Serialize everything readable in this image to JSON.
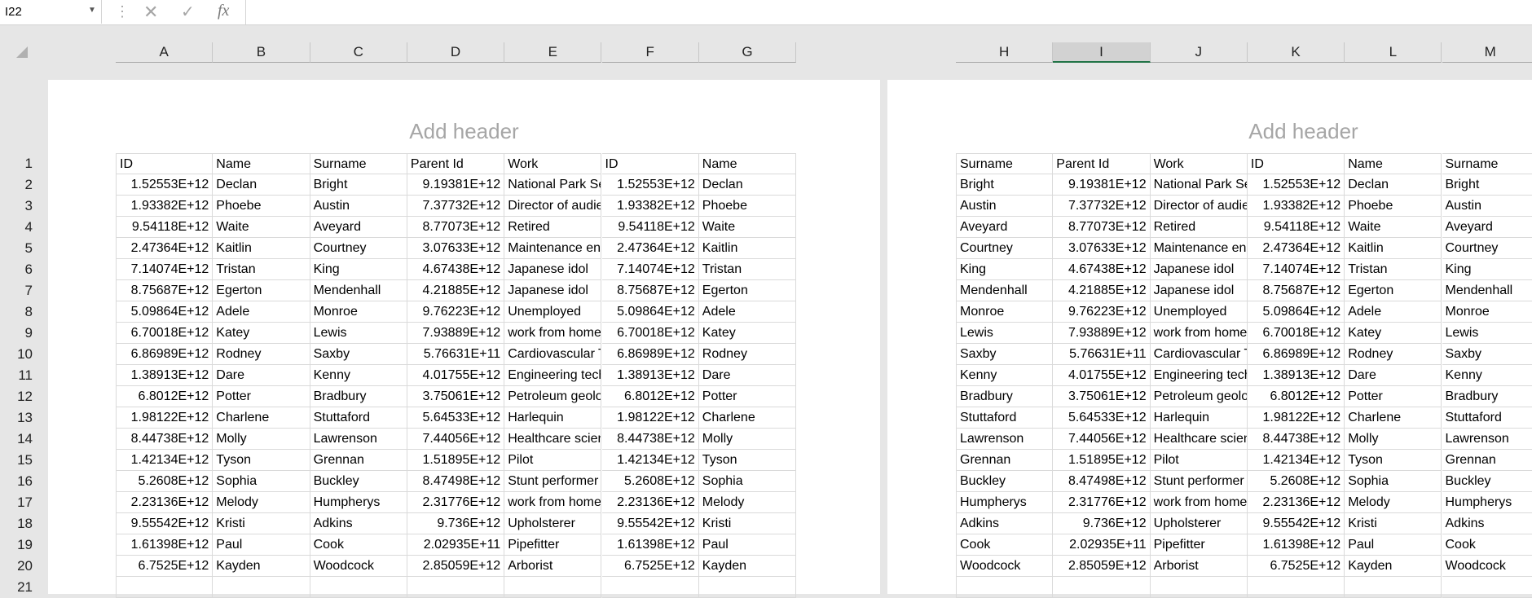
{
  "formula_bar": {
    "name_box": "I22",
    "fx_label": "fx",
    "cancel_glyph": "✕",
    "enter_glyph": "✓",
    "formula_value": ""
  },
  "columns_left": [
    "A",
    "B",
    "C",
    "D",
    "E",
    "F",
    "G"
  ],
  "columns_right": [
    "H",
    "I",
    "J",
    "K",
    "L",
    "M"
  ],
  "selected_column": "I",
  "row_numbers": [
    "1",
    "2",
    "3",
    "4",
    "5",
    "6",
    "7",
    "8",
    "9",
    "10",
    "11",
    "12",
    "13",
    "14",
    "15",
    "16",
    "17",
    "18",
    "19",
    "20",
    "21"
  ],
  "page_header_placeholder": "Add header",
  "rows": [
    [
      "ID",
      "Name",
      "Surname",
      "Parent Id",
      "Work",
      "ID",
      "Name",
      "Surname",
      "Parent Id",
      "Work",
      "ID",
      "Name",
      "Surname"
    ],
    [
      "1.52553E+12",
      "Declan",
      "Bright",
      "9.19381E+12",
      "National Park Service",
      "1.52553E+12",
      "Declan",
      "Bright",
      "9.19381E+12",
      "National Park Service",
      "1.52553E+12",
      "Declan",
      "Bright"
    ],
    [
      "1.93382E+12",
      "Phoebe",
      "Austin",
      "7.37732E+12",
      "Director of audience",
      "1.93382E+12",
      "Phoebe",
      "Austin",
      "7.37732E+12",
      "Director of audience",
      "1.93382E+12",
      "Phoebe",
      "Austin"
    ],
    [
      "9.54118E+12",
      "Waite",
      "Aveyard",
      "8.77073E+12",
      "Retired",
      "9.54118E+12",
      "Waite",
      "Aveyard",
      "8.77073E+12",
      "Retired",
      "9.54118E+12",
      "Waite",
      "Aveyard"
    ],
    [
      "2.47364E+12",
      "Kaitlin",
      "Courtney",
      "3.07633E+12",
      "Maintenance engineer",
      "2.47364E+12",
      "Kaitlin",
      "Courtney",
      "3.07633E+12",
      "Maintenance engineer",
      "2.47364E+12",
      "Kaitlin",
      "Courtney"
    ],
    [
      "7.14074E+12",
      "Tristan",
      "King",
      "4.67438E+12",
      "Japanese idol",
      "7.14074E+12",
      "Tristan",
      "King",
      "4.67438E+12",
      "Japanese idol",
      "7.14074E+12",
      "Tristan",
      "King"
    ],
    [
      "8.75687E+12",
      "Egerton",
      "Mendenhall",
      "4.21885E+12",
      "Japanese idol",
      "8.75687E+12",
      "Egerton",
      "Mendenhall",
      "4.21885E+12",
      "Japanese idol",
      "8.75687E+12",
      "Egerton",
      "Mendenhall"
    ],
    [
      "5.09864E+12",
      "Adele",
      "Monroe",
      "9.76223E+12",
      "Unemployed",
      "5.09864E+12",
      "Adele",
      "Monroe",
      "9.76223E+12",
      "Unemployed",
      "5.09864E+12",
      "Adele",
      "Monroe"
    ],
    [
      "6.70018E+12",
      "Katey",
      "Lewis",
      "7.93889E+12",
      "work from home",
      "6.70018E+12",
      "Katey",
      "Lewis",
      "7.93889E+12",
      "work from home",
      "6.70018E+12",
      "Katey",
      "Lewis"
    ],
    [
      "6.86989E+12",
      "Rodney",
      "Saxby",
      "5.76631E+11",
      "Cardiovascular Technologist",
      "6.86989E+12",
      "Rodney",
      "Saxby",
      "5.76631E+11",
      "Cardiovascular Technologist",
      "6.86989E+12",
      "Rodney",
      "Saxby"
    ],
    [
      "1.38913E+12",
      "Dare",
      "Kenny",
      "4.01755E+12",
      "Engineering technician",
      "1.38913E+12",
      "Dare",
      "Kenny",
      "4.01755E+12",
      "Engineering technician",
      "1.38913E+12",
      "Dare",
      "Kenny"
    ],
    [
      "6.8012E+12",
      "Potter",
      "Bradbury",
      "3.75061E+12",
      "Petroleum geologist",
      "6.8012E+12",
      "Potter",
      "Bradbury",
      "3.75061E+12",
      "Petroleum geologist",
      "6.8012E+12",
      "Potter",
      "Bradbury"
    ],
    [
      "1.98122E+12",
      "Charlene",
      "Stuttaford",
      "5.64533E+12",
      "Harlequin",
      "1.98122E+12",
      "Charlene",
      "Stuttaford",
      "5.64533E+12",
      "Harlequin",
      "1.98122E+12",
      "Charlene",
      "Stuttaford"
    ],
    [
      "8.44738E+12",
      "Molly",
      "Lawrenson",
      "7.44056E+12",
      "Healthcare scientist",
      "8.44738E+12",
      "Molly",
      "Lawrenson",
      "7.44056E+12",
      "Healthcare scientist",
      "8.44738E+12",
      "Molly",
      "Lawrenson"
    ],
    [
      "1.42134E+12",
      "Tyson",
      "Grennan",
      "1.51895E+12",
      "Pilot",
      "1.42134E+12",
      "Tyson",
      "Grennan",
      "1.51895E+12",
      "Pilot",
      "1.42134E+12",
      "Tyson",
      "Grennan"
    ],
    [
      "5.2608E+12",
      "Sophia",
      "Buckley",
      "8.47498E+12",
      "Stunt performer",
      "5.2608E+12",
      "Sophia",
      "Buckley",
      "8.47498E+12",
      "Stunt performer",
      "5.2608E+12",
      "Sophia",
      "Buckley"
    ],
    [
      "2.23136E+12",
      "Melody",
      "Humpherys",
      "2.31776E+12",
      "work from home",
      "2.23136E+12",
      "Melody",
      "Humpherys",
      "2.31776E+12",
      "work from home",
      "2.23136E+12",
      "Melody",
      "Humpherys"
    ],
    [
      "9.55542E+12",
      "Kristi",
      "Adkins",
      "9.736E+12",
      "Upholsterer",
      "9.55542E+12",
      "Kristi",
      "Adkins",
      "9.736E+12",
      "Upholsterer",
      "9.55542E+12",
      "Kristi",
      "Adkins"
    ],
    [
      "1.61398E+12",
      "Paul",
      "Cook",
      "2.02935E+11",
      "Pipefitter",
      "1.61398E+12",
      "Paul",
      "Cook",
      "2.02935E+11",
      "Pipefitter",
      "1.61398E+12",
      "Paul",
      "Cook"
    ],
    [
      "6.7525E+12",
      "Kayden",
      "Woodcock",
      "2.85059E+12",
      "Arborist",
      "6.7525E+12",
      "Kayden",
      "Woodcock",
      "2.85059E+12",
      "Arborist",
      "6.7525E+12",
      "Kayden",
      "Woodcock"
    ],
    [
      "",
      "",
      "",
      "",
      "",
      "",
      "",
      "",
      "",
      "",
      "",
      "",
      ""
    ]
  ]
}
